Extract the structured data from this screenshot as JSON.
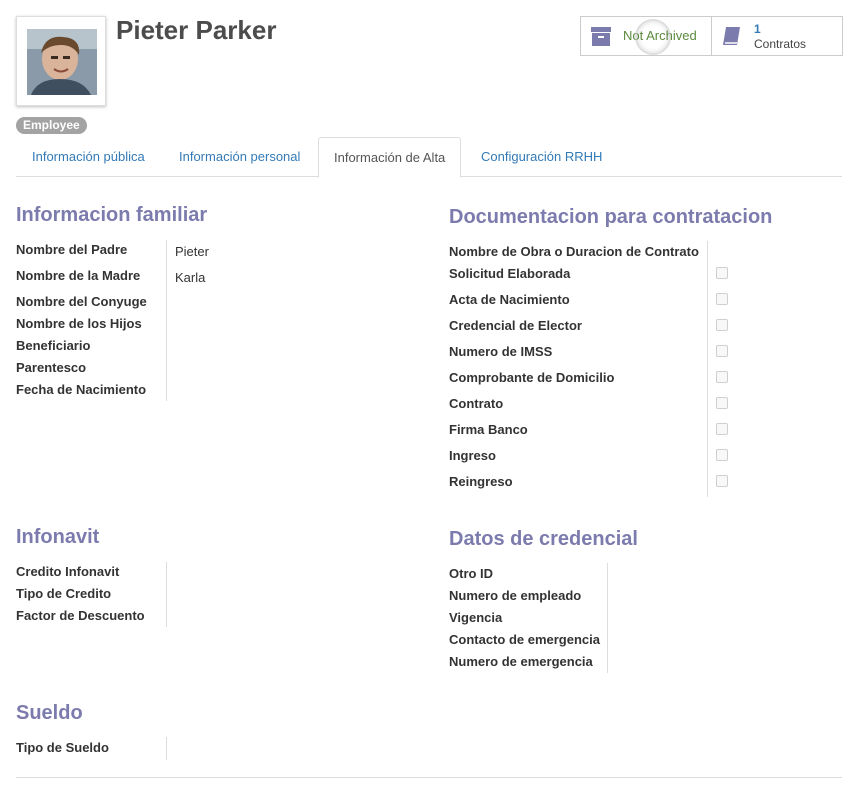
{
  "employee": {
    "name": "Pieter Parker",
    "tag": "Employee"
  },
  "buttons": {
    "archive_label": "Not Archived",
    "contracts_count": "1",
    "contracts_label": "Contratos"
  },
  "tabs": [
    {
      "label": "Información pública"
    },
    {
      "label": "Información personal"
    },
    {
      "label": "Información de Alta"
    },
    {
      "label": "Configuración RRHH"
    }
  ],
  "familiar": {
    "title": "Informacion familiar",
    "fields": [
      {
        "label": "Nombre del Padre",
        "value": "Pieter"
      },
      {
        "label": "Nombre de la Madre",
        "value": "Karla"
      },
      {
        "label": "Nombre del Conyuge",
        "value": ""
      },
      {
        "label": "Nombre de los Hijos",
        "value": ""
      },
      {
        "label": "Beneficiario",
        "value": ""
      },
      {
        "label": "Parentesco",
        "value": ""
      },
      {
        "label": "Fecha de Nacimiento",
        "value": ""
      }
    ]
  },
  "documentacion": {
    "title": "Documentacion para contratacion",
    "fields": [
      {
        "label": "Nombre de Obra o Duracion de Contrato",
        "checked": false
      },
      {
        "label": "Solicitud Elaborada",
        "checked": false
      },
      {
        "label": "Acta de Nacimiento",
        "checked": false
      },
      {
        "label": "Credencial de Elector",
        "checked": false
      },
      {
        "label": "Numero de IMSS",
        "checked": false
      },
      {
        "label": "Comprobante de Domicilio",
        "checked": false
      },
      {
        "label": "Contrato",
        "checked": false
      },
      {
        "label": "Firma Banco",
        "checked": false
      },
      {
        "label": "Ingreso",
        "checked": false
      },
      {
        "label": "Reingreso",
        "checked": false
      }
    ]
  },
  "infonavit": {
    "title": "Infonavit",
    "fields": [
      {
        "label": "Credito Infonavit"
      },
      {
        "label": "Tipo de Credito"
      },
      {
        "label": "Factor de Descuento"
      }
    ]
  },
  "credencial": {
    "title": "Datos de credencial",
    "fields": [
      {
        "label": "Otro ID"
      },
      {
        "label": "Numero de empleado"
      },
      {
        "label": "Vigencia"
      },
      {
        "label": "Contacto de emergencia"
      },
      {
        "label": "Numero de emergencia"
      }
    ]
  },
  "sueldo": {
    "title": "Sueldo",
    "fields": [
      {
        "label": "Tipo de Sueldo"
      }
    ]
  }
}
